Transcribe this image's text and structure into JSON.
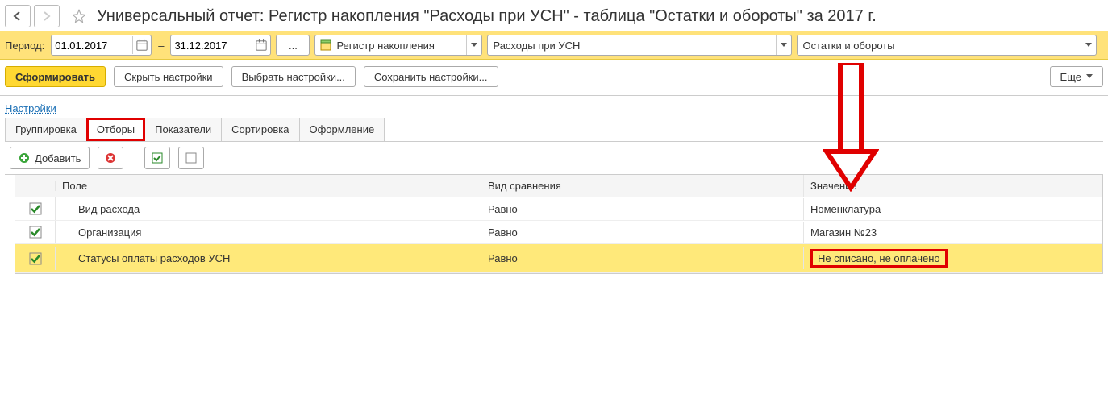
{
  "title": "Универсальный отчет: Регистр накопления \"Расходы при УСН\" - таблица \"Остатки и обороты\" за 2017 г.",
  "period": {
    "label": "Период:",
    "from": "01.01.2017",
    "to": "31.12.2017",
    "dash": "–",
    "more": "..."
  },
  "selectors": {
    "register_type": "Регистр накопления",
    "register_name": "Расходы при УСН",
    "table_name": "Остатки и обороты"
  },
  "actions": {
    "generate": "Сформировать",
    "hide_settings": "Скрыть настройки",
    "choose_settings": "Выбрать настройки...",
    "save_settings": "Сохранить настройки...",
    "more": "Еще"
  },
  "settings": {
    "title": "Настройки",
    "tabs": {
      "grouping": "Группировка",
      "filters": "Отборы",
      "measures": "Показатели",
      "sorting": "Сортировка",
      "design": "Оформление"
    }
  },
  "filter_toolbar": {
    "add": "Добавить"
  },
  "filter_table": {
    "headers": {
      "field": "Поле",
      "comparison": "Вид сравнения",
      "value": "Значение"
    },
    "rows": [
      {
        "checked": true,
        "field": "Вид расхода",
        "comparison": "Равно",
        "value": "Номенклатура",
        "selected": false,
        "hl": false
      },
      {
        "checked": true,
        "field": "Организация",
        "comparison": "Равно",
        "value": "Магазин №23",
        "selected": false,
        "hl": false
      },
      {
        "checked": true,
        "field": "Статусы оплаты расходов УСН",
        "comparison": "Равно",
        "value": "Не списано, не оплачено",
        "selected": true,
        "hl": true
      }
    ]
  }
}
